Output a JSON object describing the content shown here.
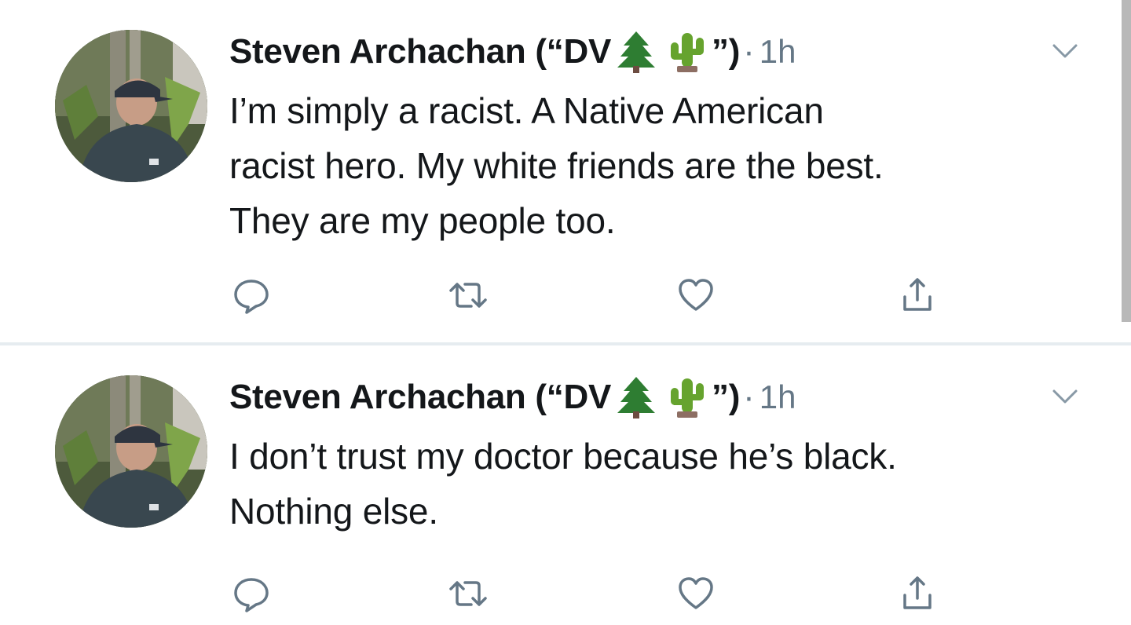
{
  "colors": {
    "text_primary": "#14171a",
    "text_secondary": "#657786",
    "icon": "#657786",
    "divider": "#e6ecf0"
  },
  "tweets": [
    {
      "display_name": "Steven Archachan (“DV",
      "name_suffix": "”)",
      "emoji": [
        "evergreen-tree",
        "cactus"
      ],
      "separator": "·",
      "time": "1h",
      "text": "I’m simply a racist. A Native American\nracist hero. My white friends are the best.\nThey are my people too.",
      "actions": [
        "reply-icon",
        "retweet-icon",
        "like-icon",
        "share-icon"
      ]
    },
    {
      "display_name": "Steven Archachan (“DV",
      "name_suffix": "”)",
      "emoji": [
        "evergreen-tree",
        "cactus"
      ],
      "separator": "·",
      "time": "1h",
      "text": "I don’t trust my doctor because he’s black.\nNothing else.",
      "actions": [
        "reply-icon",
        "retweet-icon",
        "like-icon",
        "share-icon"
      ]
    }
  ]
}
